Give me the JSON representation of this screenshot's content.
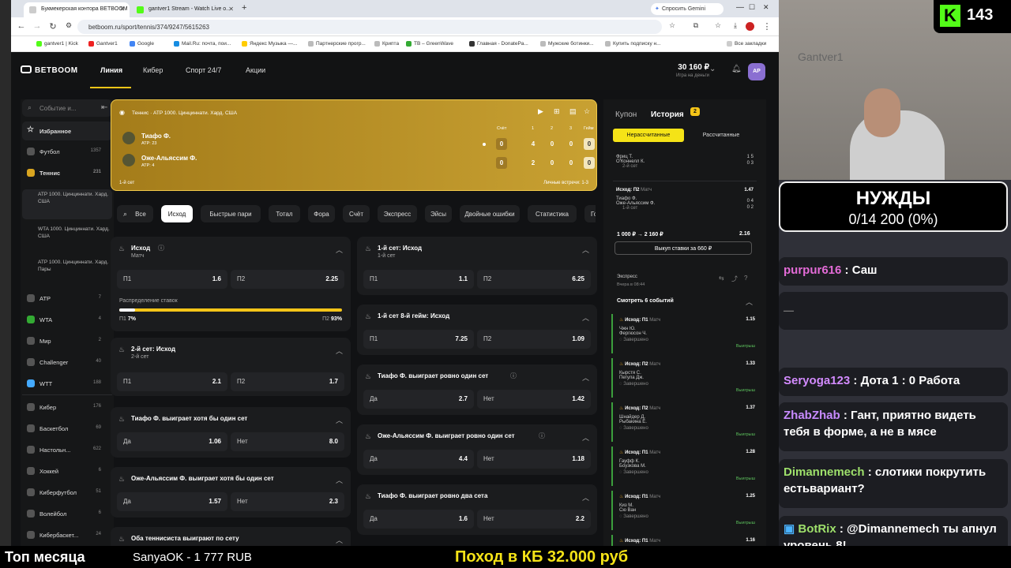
{
  "browser": {
    "tabs": [
      {
        "label": "Букмекерская контора BETBOOM",
        "active": true,
        "icon_color": "#e5e5e5"
      },
      {
        "label": "gantver1 Stream - Watch Live o...",
        "active": false,
        "icon_color": "#53fc18"
      }
    ],
    "new_tab": "+",
    "gemini": "Спросить Gemini",
    "url": "betboom.ru/sport/tennis/374/9247/5615263",
    "bookmarks": [
      "gantver1 | Kick",
      "Gantver1",
      "Google",
      "Mail.Ru: почта, пои...",
      "Яндекс Музыка —...",
      "Партнерские прогр...",
      "Крипта",
      "ТВ – GreenWave",
      "Главная - DonatePa...",
      "Мужские ботинки...",
      "Купить подписку н..."
    ],
    "all_bookmarks": "Все закладки"
  },
  "site": {
    "logo": "BETBOOM",
    "nav": [
      "Линия",
      "Кибер",
      "Спорт 24/7",
      "Акции"
    ],
    "balance": "30 160 ₽",
    "balance_sub": "Игра на деньги",
    "avatar": "АР"
  },
  "sidebar": {
    "search": "Событие и...",
    "items": [
      {
        "label": "Избранное",
        "count": ""
      },
      {
        "label": "Футбол",
        "count": "1357"
      },
      {
        "label": "Теннис",
        "count": "231"
      }
    ],
    "subs": [
      "ATP 1000. Цинциннати. Хард. США",
      "WTA 1000. Цинциннати. Хард. США",
      "ATP 1000. Цинциннати. Хард. Пары"
    ],
    "cats": [
      {
        "label": "ATP",
        "count": "7"
      },
      {
        "label": "WTA",
        "count": "4"
      },
      {
        "label": "Мир",
        "count": "2"
      },
      {
        "label": "Challenger",
        "count": "40"
      },
      {
        "label": "WTT",
        "count": "188"
      },
      {
        "label": "Кибер",
        "count": "176"
      },
      {
        "label": "Баскетбол",
        "count": "69"
      },
      {
        "label": "Настольн...",
        "count": "622"
      },
      {
        "label": "Хоккей",
        "count": "6"
      },
      {
        "label": "Киберфутбол",
        "count": "51"
      },
      {
        "label": "Волейбол",
        "count": "6"
      },
      {
        "label": "Кибербаскет...",
        "count": "24"
      }
    ]
  },
  "match": {
    "breadcrumb": "Теннис · ATP 1000. Цинциннати. Хард. США",
    "score_headers": [
      "Счёт",
      "1",
      "2",
      "3",
      "Гейм"
    ],
    "p1": {
      "name": "Тиафо Ф.",
      "rank": "ATP: 23",
      "score": [
        "0",
        "4",
        "0",
        "0",
        "0"
      ]
    },
    "p2": {
      "name": "Оже-Альяссим Ф.",
      "rank": "ATP: 4",
      "score": [
        "0",
        "2",
        "0",
        "0",
        "0"
      ]
    },
    "set": "1-й сет",
    "h2h": "Личные встречи: 1-3"
  },
  "market_tabs": [
    "Все",
    "Исход",
    "Быстрые пари",
    "Тотал",
    "Фора",
    "Счёт",
    "Экспресс",
    "Эйсы",
    "Двойные ошибки",
    "Статистика",
    "Го"
  ],
  "markets": {
    "m1": {
      "title": "Исход",
      "sub": "Матч",
      "o1": "П1",
      "v1": "1.6",
      "o2": "П2",
      "v2": "2.25",
      "dist": "Распределение ставок",
      "p1": "П1",
      "p1v": "7%",
      "p2": "П2",
      "p2v": "93%",
      "pct1": 0.07
    },
    "m2": {
      "title": "2-й сет: Исход",
      "sub": "2-й сет",
      "o1": "П1",
      "v1": "2.1",
      "o2": "П2",
      "v2": "1.7"
    },
    "m3": {
      "title": "Тиафо Ф. выиграет хотя бы один сет",
      "o1": "Да",
      "v1": "1.06",
      "o2": "Нет",
      "v2": "8.0"
    },
    "m4": {
      "title": "Оже-Альяссим Ф. выиграет хотя бы один сет",
      "o1": "Да",
      "v1": "1.57",
      "o2": "Нет",
      "v2": "2.3"
    },
    "m5": {
      "title": "Оба теннисиста выиграют по сету"
    },
    "r1": {
      "title": "1-й сет: Исход",
      "sub": "1-й сет",
      "o1": "П1",
      "v1": "1.1",
      "o2": "П2",
      "v2": "6.25"
    },
    "r2": {
      "title": "1-й сет 8-й гейм: Исход",
      "o1": "П1",
      "v1": "7.25",
      "o2": "П2",
      "v2": "1.09"
    },
    "r3": {
      "title": "Тиафо Ф. выиграет ровно один сет",
      "o1": "Да",
      "v1": "2.7",
      "o2": "Нет",
      "v2": "1.42"
    },
    "r4": {
      "title": "Оже-Альяссим Ф. выиграет ровно один сет",
      "o1": "Да",
      "v1": "4.4",
      "o2": "Нет",
      "v2": "1.18"
    },
    "r5": {
      "title": "Тиафо Ф. выиграет ровно два сета",
      "o1": "Да",
      "v1": "1.6",
      "o2": "Нет",
      "v2": "2.2"
    }
  },
  "coupon": {
    "tab1": "Купон",
    "tab2": "История",
    "badge": "2",
    "f1": "Нерассчитанные",
    "f2": "Рассчитанные",
    "b0": {
      "p1": "Фриц Т.",
      "p2": "О'Коннелл К.",
      "set": "2-й сет",
      "s1": "1",
      "s1b": "5",
      "s2": "0",
      "s2b": "3"
    },
    "b1": {
      "title": "Исход: П2",
      "type": "Матч",
      "odd": "1.47",
      "p1": "Тиафо Ф.",
      "p2": "Оже-Альяссим Ф.",
      "set": "1-й сет",
      "s1": "0",
      "s1b": "4",
      "s2": "0",
      "s2b": "2"
    },
    "calc": "1 000 ₽ → 2 160 ₽",
    "calc_odd": "2.16",
    "cashout": "Выкуп ставки за 660 ₽",
    "express": "Экспресс",
    "express_time": "Вчера в 08:44",
    "watch": "Смотреть 6 событий",
    "legs": [
      {
        "title": "Исход: П1",
        "type": "Матч",
        "odd": "1.15",
        "p1": "Чжн Ю.",
        "p2": "Фергюсон Ч.",
        "status": "Завершено",
        "result": "Выигрыш"
      },
      {
        "title": "Исход: П2",
        "type": "Матч",
        "odd": "1.33",
        "p1": "Кырстя С.",
        "p2": "Пегула Дж.",
        "status": "Завершено",
        "result": "Выигрыш"
      },
      {
        "title": "Исход: П2",
        "type": "Матч",
        "odd": "1.37",
        "p1": "Шнайдер Д.",
        "p2": "Рыбакина Е.",
        "status": "Завершено",
        "result": "Выигрыш"
      },
      {
        "title": "Исход: П1",
        "type": "Матч",
        "odd": "1.28",
        "p1": "Гауфф К.",
        "p2": "Боузкова М.",
        "status": "Завершено",
        "result": "Выигрыш"
      },
      {
        "title": "Исход: П1",
        "type": "Матч",
        "odd": "1.25",
        "p1": "Киз М.",
        "p2": "Сю Ван",
        "status": "Завершено",
        "result": "Выигрыш"
      },
      {
        "title": "Исход: П1",
        "type": "Матч",
        "odd": "1.16",
        "p1": "",
        "p2": "",
        "status": "",
        "result": ""
      }
    ]
  },
  "stream": {
    "kick_count": "143",
    "watermark": "Gantver1",
    "needs_title": "НУЖДЫ",
    "needs_value": "0/14 200 (0%)",
    "chat": [
      {
        "user": "purpur616",
        "color": "#e36bd7",
        "text": "Саш"
      },
      {
        "user": "Seryoga123",
        "color": "#d38bff",
        "text": "Дота 1 : 0 Работа"
      },
      {
        "user": "ZhabZhab",
        "color": "#c88bff",
        "text": "Гант, приятно видеть тебя в форме, а не в мясе"
      },
      {
        "user": "Dimannemech",
        "color": "#9ee06b",
        "text": "слотики покрутить естьвариант?"
      },
      {
        "user": "BotRix",
        "color": "#9ee06b",
        "text": "@Dimannemech ты апнул уровень 8!"
      }
    ],
    "bottom_left": "Топ месяца",
    "bottom_donor": "SanyaOK - 1 777 RUB",
    "bottom_center": "Поход в КБ 32.000 руб"
  }
}
